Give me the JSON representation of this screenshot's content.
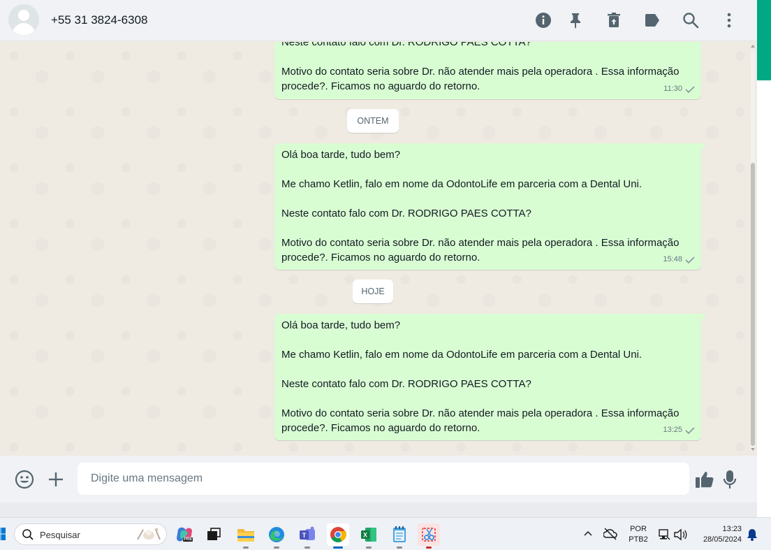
{
  "header": {
    "contact_name": "+55 31 3824-6308",
    "icons": [
      "info-icon",
      "pin-icon",
      "delete-icon",
      "label-icon",
      "search-icon",
      "menu-icon"
    ]
  },
  "chat": {
    "first_partial": {
      "line_top": "Neste contato falo com Dr. RODRIGO PAES COTTA?",
      "line_motivo_1": "Motivo do contato seria sobre Dr. não atender mais pela operadora . Essa informação",
      "line_motivo_2": "procede?. Ficamos no aguardo do retorno.",
      "time": "11:30"
    },
    "date_ontem": "ONTEM",
    "message_ontem": {
      "l1": "Olá boa tarde, tudo bem?",
      "l2": "Me chamo Ketlin, falo em nome da OdontoLife em parceria com a Dental Uni.",
      "l3": "Neste contato falo com Dr. RODRIGO PAES COTTA?",
      "l4": "Motivo do contato seria sobre Dr. não atender mais pela operadora . Essa informação",
      "l5": "procede?. Ficamos no aguardo do retorno.",
      "time": "15:48"
    },
    "date_hoje": "HOJE",
    "message_hoje": {
      "l1": "Olá boa tarde, tudo bem?",
      "l2": "Me chamo Ketlin, falo em nome da OdontoLife em parceria com a Dental Uni.",
      "l3": "Neste contato falo com Dr. RODRIGO PAES COTTA?",
      "l4": "Motivo do contato seria sobre Dr. não atender mais pela operadora . Essa informação",
      "l5": "procede?. Ficamos no aguardo do retorno.",
      "time": "13:25"
    }
  },
  "footer": {
    "input_placeholder": "Digite uma mensagem",
    "input_value": ""
  },
  "taskbar": {
    "search_text": "Pesquisar",
    "copilot_badge": "PRE",
    "lang_line1": "POR",
    "lang_line2": "PTB2",
    "time": "13:23",
    "date": "28/05/2024"
  },
  "colors": {
    "bubble_out": "#d9fdd3",
    "chat_bg": "#efeae2",
    "header_bg": "#f0f2f5",
    "accent": "#00a884"
  }
}
